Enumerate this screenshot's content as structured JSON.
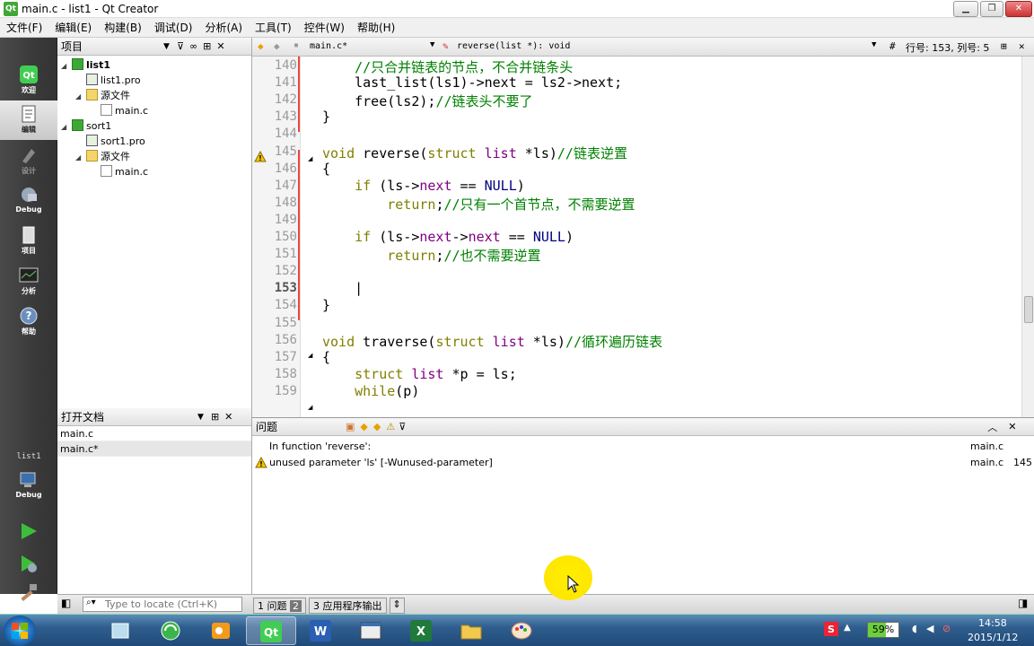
{
  "window": {
    "title": "main.c - list1 - Qt Creator",
    "app_icon": "Qt"
  },
  "menu": [
    "文件(F)",
    "编辑(E)",
    "构建(B)",
    "调试(D)",
    "分析(A)",
    "工具(T)",
    "控件(W)",
    "帮助(H)"
  ],
  "modes": [
    {
      "label": "欢迎",
      "icon": "qt-logo-icon"
    },
    {
      "label": "编辑",
      "icon": "edit-document-icon"
    },
    {
      "label": "设计",
      "icon": "design-pen-icon"
    },
    {
      "label": "Debug",
      "icon": "debug-bug-icon"
    },
    {
      "label": "项目",
      "icon": "project-icon"
    },
    {
      "label": "分析",
      "icon": "analyze-icon"
    },
    {
      "label": "帮助",
      "icon": "help-icon"
    }
  ],
  "kit": {
    "project": "list1",
    "label": "Debug"
  },
  "projects": {
    "header": "项目",
    "tree": [
      {
        "label": "list1",
        "kind": "qt",
        "bold": true,
        "arrow": "◢"
      },
      {
        "label": "list1.pro",
        "kind": "pro",
        "arrow": ""
      },
      {
        "label": "源文件",
        "kind": "folder",
        "arrow": "◢"
      },
      {
        "label": "main.c",
        "kind": "file",
        "arrow": ""
      },
      {
        "label": "sort1",
        "kind": "qt",
        "bold": false,
        "arrow": "◢"
      },
      {
        "label": "sort1.pro",
        "kind": "pro",
        "arrow": ""
      },
      {
        "label": "源文件",
        "kind": "folder",
        "arrow": "◢"
      },
      {
        "label": "main.c",
        "kind": "file",
        "arrow": ""
      }
    ]
  },
  "open_docs": {
    "header": "打开文档",
    "items": [
      "main.c",
      "main.c*"
    ]
  },
  "editor_toolbar": {
    "file": "main.c*",
    "symbol": "reverse(list *): void",
    "position": "行号: 153, 列号: 5"
  },
  "code_lines": [
    {
      "n": "140",
      "segs": [
        [
          "    ",
          ""
        ],
        [
          "//只合并链表的节点，不合并链条头",
          "cm"
        ]
      ]
    },
    {
      "n": "141",
      "segs": [
        [
          "    last_list(ls1)->next = ls2->next;",
          ""
        ]
      ]
    },
    {
      "n": "142",
      "segs": [
        [
          "    free(ls2);",
          ""
        ],
        [
          "//链表头不要了",
          "cm"
        ]
      ]
    },
    {
      "n": "143",
      "segs": [
        [
          "}",
          ""
        ]
      ]
    },
    {
      "n": "144",
      "segs": []
    },
    {
      "n": "145",
      "segs": [
        [
          "void",
          "kw"
        ],
        [
          " reverse(",
          ""
        ],
        [
          "struct",
          "kw"
        ],
        [
          " ",
          ""
        ],
        [
          "list",
          "ty"
        ],
        [
          " *ls)",
          ""
        ],
        [
          "//链表逆置",
          "cm"
        ]
      ]
    },
    {
      "n": "146",
      "segs": [
        [
          "{",
          ""
        ]
      ]
    },
    {
      "n": "147",
      "segs": [
        [
          "    ",
          ""
        ],
        [
          "if",
          "kw"
        ],
        [
          " (ls->",
          ""
        ],
        [
          "next",
          "ty"
        ],
        [
          " == ",
          ""
        ],
        [
          "NULL",
          "mc"
        ],
        [
          ")",
          ""
        ]
      ]
    },
    {
      "n": "148",
      "segs": [
        [
          "        ",
          ""
        ],
        [
          "return",
          "kw"
        ],
        [
          ";",
          ""
        ],
        [
          "//只有一个首节点，不需要逆置",
          "cm"
        ]
      ]
    },
    {
      "n": "149",
      "segs": []
    },
    {
      "n": "150",
      "segs": [
        [
          "    ",
          ""
        ],
        [
          "if",
          "kw"
        ],
        [
          " (ls->",
          ""
        ],
        [
          "next",
          "ty"
        ],
        [
          "->",
          ""
        ],
        [
          "next",
          "ty"
        ],
        [
          " == ",
          ""
        ],
        [
          "NULL",
          "mc"
        ],
        [
          ")",
          ""
        ]
      ]
    },
    {
      "n": "151",
      "segs": [
        [
          "        ",
          ""
        ],
        [
          "return",
          "kw"
        ],
        [
          ";",
          ""
        ],
        [
          "//也不需要逆置",
          "cm"
        ]
      ]
    },
    {
      "n": "152",
      "segs": []
    },
    {
      "n": "153",
      "segs": [
        [
          "    |",
          ""
        ]
      ]
    },
    {
      "n": "154",
      "segs": [
        [
          "}",
          ""
        ]
      ]
    },
    {
      "n": "155",
      "segs": []
    },
    {
      "n": "156",
      "segs": [
        [
          "void",
          "kw"
        ],
        [
          " traverse(",
          ""
        ],
        [
          "struct",
          "kw"
        ],
        [
          " ",
          ""
        ],
        [
          "list",
          "ty"
        ],
        [
          " *ls)",
          ""
        ],
        [
          "//循环遍历链表",
          "cm"
        ]
      ]
    },
    {
      "n": "157",
      "segs": [
        [
          "{",
          ""
        ]
      ]
    },
    {
      "n": "158",
      "segs": [
        [
          "    ",
          ""
        ],
        [
          "struct",
          "kw"
        ],
        [
          " ",
          ""
        ],
        [
          "list",
          "ty"
        ],
        [
          " *p = ls;",
          ""
        ]
      ]
    },
    {
      "n": "159",
      "segs": [
        [
          "    ",
          ""
        ],
        [
          "while",
          "kw"
        ],
        [
          "(p)",
          ""
        ]
      ]
    }
  ],
  "current_line": "153",
  "issues": {
    "header": "问题",
    "rows": [
      {
        "text": "In function 'reverse':",
        "file": "main.c",
        "line": "",
        "warn": false
      },
      {
        "text": "unused parameter 'ls' [-Wunused-parameter]",
        "file": "main.c",
        "line": "145",
        "warn": true
      }
    ]
  },
  "locator": {
    "placeholder": "Type to locate (Ctrl+K)",
    "tabs": [
      {
        "num": "1",
        "label": "问题",
        "badge": "2"
      },
      {
        "num": "3",
        "label": "应用程序输出",
        "badge": ""
      }
    ]
  },
  "taskbar": {
    "battery": "59%",
    "time": "14:58",
    "date": "2015/1/12",
    "apps": [
      "ie-icon",
      "globe-icon",
      "outlook-icon",
      "qt-icon",
      "word-icon",
      "window-icon",
      "excel-icon",
      "folder-icon",
      "paint-icon"
    ]
  },
  "colors": {
    "comment": "#008000",
    "keyword": "#808000",
    "type": "#800080",
    "macro": "#000080",
    "cursor_highlight": "#ffee00"
  }
}
